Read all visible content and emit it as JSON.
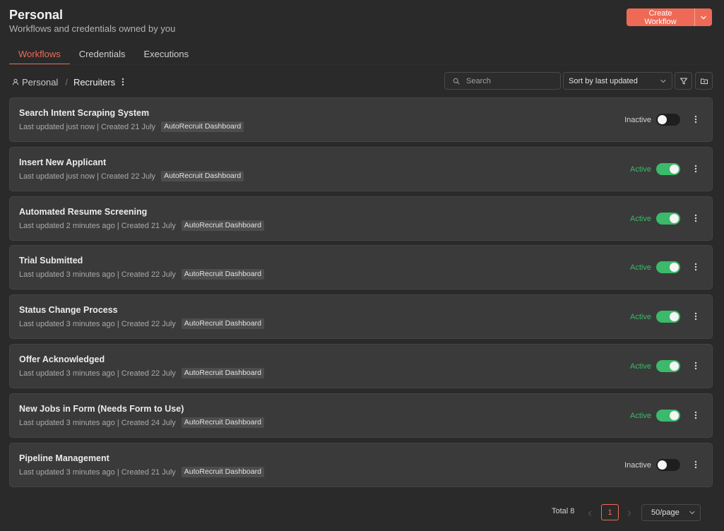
{
  "header": {
    "title": "Personal",
    "subtitle": "Workflows and credentials owned by you",
    "create_label": "Create Workflow"
  },
  "tabs": [
    {
      "label": "Workflows",
      "active": true
    },
    {
      "label": "Credentials",
      "active": false
    },
    {
      "label": "Executions",
      "active": false
    }
  ],
  "breadcrumb": {
    "root": "Personal",
    "separator": "/",
    "current": "Recruiters"
  },
  "toolbar": {
    "search_placeholder": "Search",
    "sort_label": "Sort by last updated"
  },
  "colors": {
    "accent": "#ee6a57",
    "active": "#3cb96b",
    "card_bg": "#3a3a3a",
    "page_bg": "#2a2a2a"
  },
  "workflows": [
    {
      "name": "Search Intent Scraping System",
      "updated": "Last updated just now",
      "created": "Created 21 July",
      "tag": "AutoRecruit Dashboard",
      "status": "Inactive",
      "active": false
    },
    {
      "name": "Insert New Applicant",
      "updated": "Last updated just now",
      "created": "Created 22 July",
      "tag": "AutoRecruit Dashboard",
      "status": "Active",
      "active": true
    },
    {
      "name": "Automated Resume Screening",
      "updated": "Last updated 2 minutes ago",
      "created": "Created 21 July",
      "tag": "AutoRecruit Dashboard",
      "status": "Active",
      "active": true
    },
    {
      "name": "Trial Submitted",
      "updated": "Last updated 3 minutes ago",
      "created": "Created 22 July",
      "tag": "AutoRecruit Dashboard",
      "status": "Active",
      "active": true
    },
    {
      "name": "Status Change Process",
      "updated": "Last updated 3 minutes ago",
      "created": "Created 22 July",
      "tag": "AutoRecruit Dashboard",
      "status": "Active",
      "active": true
    },
    {
      "name": "Offer Acknowledged",
      "updated": "Last updated 3 minutes ago",
      "created": "Created 22 July",
      "tag": "AutoRecruit Dashboard",
      "status": "Active",
      "active": true
    },
    {
      "name": "New Jobs in Form (Needs Form to Use)",
      "updated": "Last updated 3 minutes ago",
      "created": "Created 24 July",
      "tag": "AutoRecruit Dashboard",
      "status": "Active",
      "active": true
    },
    {
      "name": "Pipeline Management",
      "updated": "Last updated 3 minutes ago",
      "created": "Created 21 July",
      "tag": "AutoRecruit Dashboard",
      "status": "Inactive",
      "active": false
    }
  ],
  "pagination": {
    "total_label": "Total 8",
    "current_page": "1",
    "page_size_label": "50/page"
  },
  "icons": {
    "user": "user-icon",
    "more": "more-vertical-icon",
    "search": "search-icon",
    "chevron": "chevron-down-icon",
    "filter": "filter-icon",
    "folder": "folder-icon"
  }
}
